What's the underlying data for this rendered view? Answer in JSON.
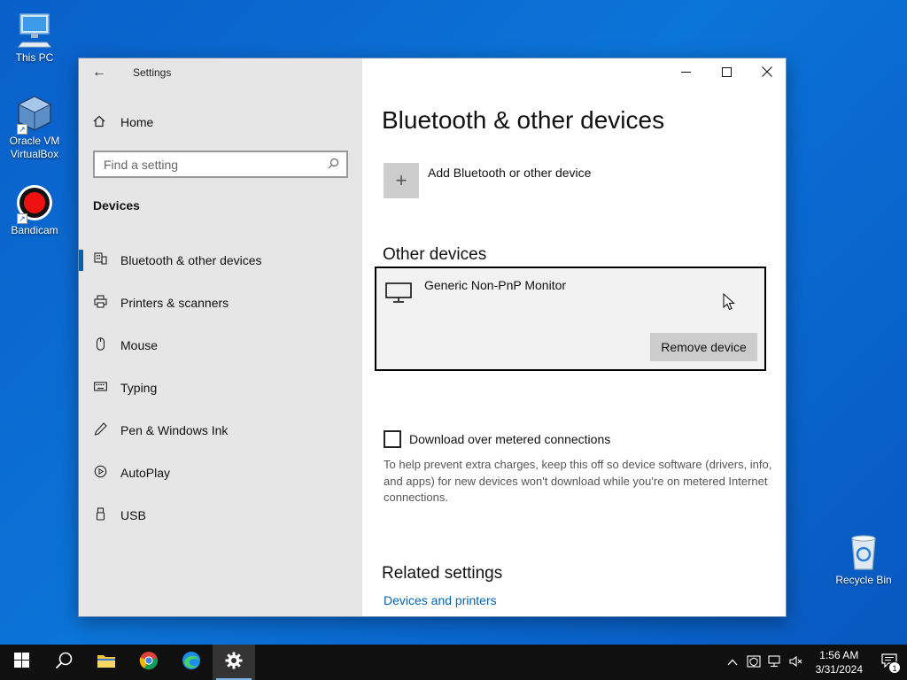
{
  "desktop": {
    "icons": [
      {
        "label": "This PC"
      },
      {
        "label": "Oracle VM VirtualBox"
      },
      {
        "label": "Bandicam"
      },
      {
        "label": "Recycle Bin"
      }
    ]
  },
  "window": {
    "app_title": "Settings",
    "sidebar": {
      "home_label": "Home",
      "search_placeholder": "Find a setting",
      "section_label": "Devices",
      "items": [
        {
          "label": "Bluetooth & other devices",
          "icon": "bluetooth-devices-icon",
          "active": true
        },
        {
          "label": "Printers & scanners",
          "icon": "printer-icon",
          "active": false
        },
        {
          "label": "Mouse",
          "icon": "mouse-icon",
          "active": false
        },
        {
          "label": "Typing",
          "icon": "keyboard-icon",
          "active": false
        },
        {
          "label": "Pen & Windows Ink",
          "icon": "pen-icon",
          "active": false
        },
        {
          "label": "AutoPlay",
          "icon": "autoplay-icon",
          "active": false
        },
        {
          "label": "USB",
          "icon": "usb-icon",
          "active": false
        }
      ]
    },
    "content": {
      "page_title": "Bluetooth & other devices",
      "add_device_label": "Add Bluetooth or other device",
      "other_devices_title": "Other devices",
      "device": {
        "name": "Generic Non-PnP Monitor",
        "remove_label": "Remove device"
      },
      "metered": {
        "label": "Download over metered connections",
        "checked": false,
        "help_text": "To help prevent extra charges, keep this off so device software (drivers, info, and apps) for new devices won't download while you're on metered Internet connections."
      },
      "related_title": "Related settings",
      "related_link": "Devices and printers"
    }
  },
  "taskbar": {
    "time": "1:56 AM",
    "date": "3/31/2024",
    "notification_count": "1",
    "accent": "#0063b1"
  }
}
